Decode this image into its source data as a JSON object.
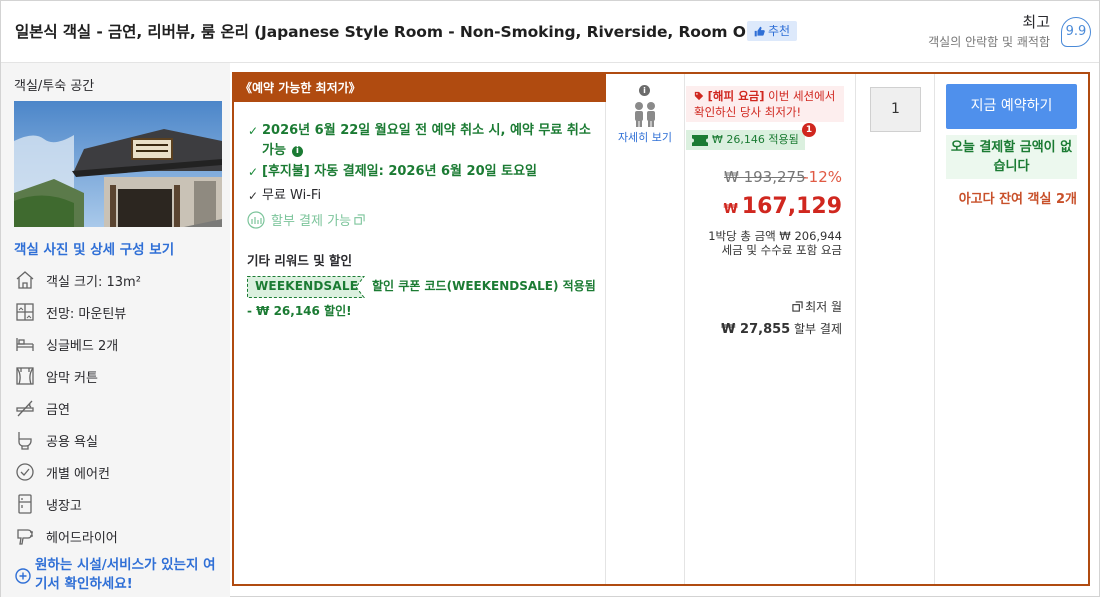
{
  "header": {
    "room_title": "일본식 객실 - 금연, 리버뷰, 룸 온리 (Japanese Style Room - Non-Smoking, Riverside, Room Only)",
    "recommend_label": "추천",
    "rating_word": "최고",
    "rating_sub": "객실의 안락함 및 쾌적함",
    "rating_score": "9.9"
  },
  "left": {
    "title": "객실/투숙 공간",
    "photo_link": "객실 사진 및 상세 구성 보기",
    "amenities": [
      {
        "icon": "house-icon",
        "label": "객실 크기: 13m²"
      },
      {
        "icon": "window-view-icon",
        "label": "전망: 마운틴뷰"
      },
      {
        "icon": "bed-icon",
        "label": "싱글베드 2개"
      },
      {
        "icon": "curtain-icon",
        "label": "암막 커튼"
      },
      {
        "icon": "no-smoking-icon",
        "label": "금연"
      },
      {
        "icon": "shared-bath-icon",
        "label": "공용 욕실"
      },
      {
        "icon": "air-conditioner-icon",
        "label": "개별 에어컨"
      },
      {
        "icon": "fridge-icon",
        "label": "냉장고"
      },
      {
        "icon": "hair-dryer-icon",
        "label": "헤어드라이어"
      }
    ],
    "more_link": "원하는 시설/서비스가 있는지 여기서 확인하세요!"
  },
  "offer": {
    "ribbon": "《예약 가능한 최저가》",
    "conditions": {
      "free_cancel": "2026년 6월 22일 월요일 전 예약 취소 시, 예약 무료 취소 가능",
      "pay_later_prefix": "[후지불]",
      "pay_later_rest": " 자동 결제일: 2026년 6월 20일 토요일",
      "wifi": "무료 Wi-Fi"
    },
    "installment": "할부 결제 가능",
    "other_title": "기타 리워드 및 할인",
    "coupon_code": "WEEKENDSALE",
    "coupon_text": "할인 쿠폰 코드(WEEKENDSALE) 적용됨",
    "coupon_discount": "- ₩ 26,146 할인!",
    "occupancy_link": "자세히 보기"
  },
  "price": {
    "happy_tag": "[해피 요금]",
    "happy_text": " 이번 세션에서 확인하신 당사 최저가!",
    "applied": "₩ 26,146 적용됨",
    "applied_badge": "1",
    "original": "₩ 193,275",
    "discount_pct": "-12%",
    "currency": "₩",
    "current": "167,129",
    "total_line": "1박당 총 금액 ₩ 206,944",
    "tax_line": "세금 및 수수료 포함 요금",
    "installment_low": "최저 월",
    "installment_amount": "₩ 27,855",
    "installment_suffix": " 할부 결제"
  },
  "quantity": "1",
  "book": {
    "button": "지금 예약하기",
    "no_pay_today": "오늘 결제할 금액이 없습니다",
    "rooms_left": "아고다 잔여 객실 2개"
  },
  "colors": {
    "accent_blue": "#2f6fd6",
    "offer_border": "#b04b10",
    "price_red": "#d0271f",
    "green": "#1b7b33",
    "button_blue": "#4f90ec"
  }
}
